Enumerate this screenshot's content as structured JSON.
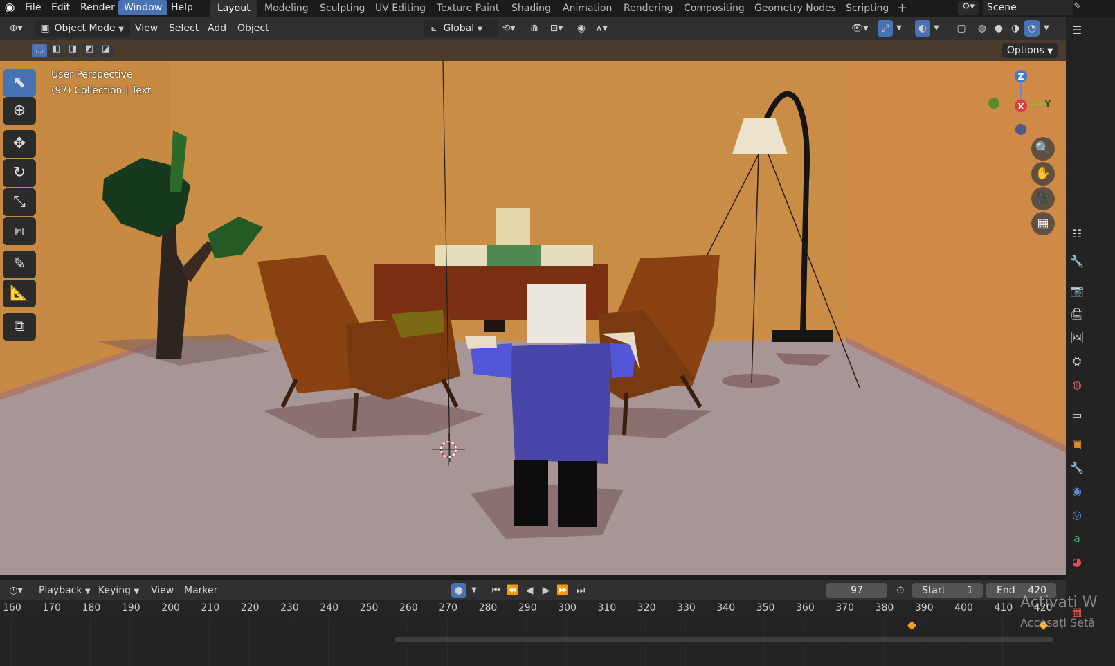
{
  "topbar": {
    "menus": [
      "File",
      "Edit",
      "Render",
      "Window",
      "Help"
    ],
    "active_menu": "Window",
    "workspaces": [
      "Layout",
      "Modeling",
      "Sculpting",
      "UV Editing",
      "Texture Paint",
      "Shading",
      "Animation",
      "Rendering",
      "Compositing",
      "Geometry Nodes",
      "Scripting"
    ],
    "active_workspace": "Layout",
    "add_workspace": "+",
    "scene_label": "Scene"
  },
  "header": {
    "mode": "Object Mode",
    "menus": [
      "View",
      "Select",
      "Add",
      "Object"
    ],
    "orientation": "Global"
  },
  "toolrow": {
    "options_label": "Options"
  },
  "viewport": {
    "perspective_label": "User Perspective",
    "collection_label": "(97) Collection | Text",
    "gizmo": {
      "z": "Z",
      "x": "X",
      "y": "Y"
    }
  },
  "timeline": {
    "menus": [
      "Playback",
      "Keying",
      "View",
      "Marker"
    ],
    "current_frame": "97",
    "start_label": "Start",
    "start_value": "1",
    "end_label": "End",
    "end_value": "420",
    "ticks": [
      "160",
      "170",
      "180",
      "190",
      "200",
      "210",
      "220",
      "230",
      "240",
      "250",
      "260",
      "270",
      "280",
      "290",
      "300",
      "310",
      "320",
      "330",
      "340",
      "350",
      "360",
      "370",
      "380",
      "390",
      "400",
      "410",
      "420"
    ]
  },
  "watermark": {
    "line1": "Activati W",
    "line2": "Accesați Setă"
  },
  "colors": {
    "accent": "#4772b3",
    "wall": "#c58a44",
    "floor": "#a89696"
  }
}
